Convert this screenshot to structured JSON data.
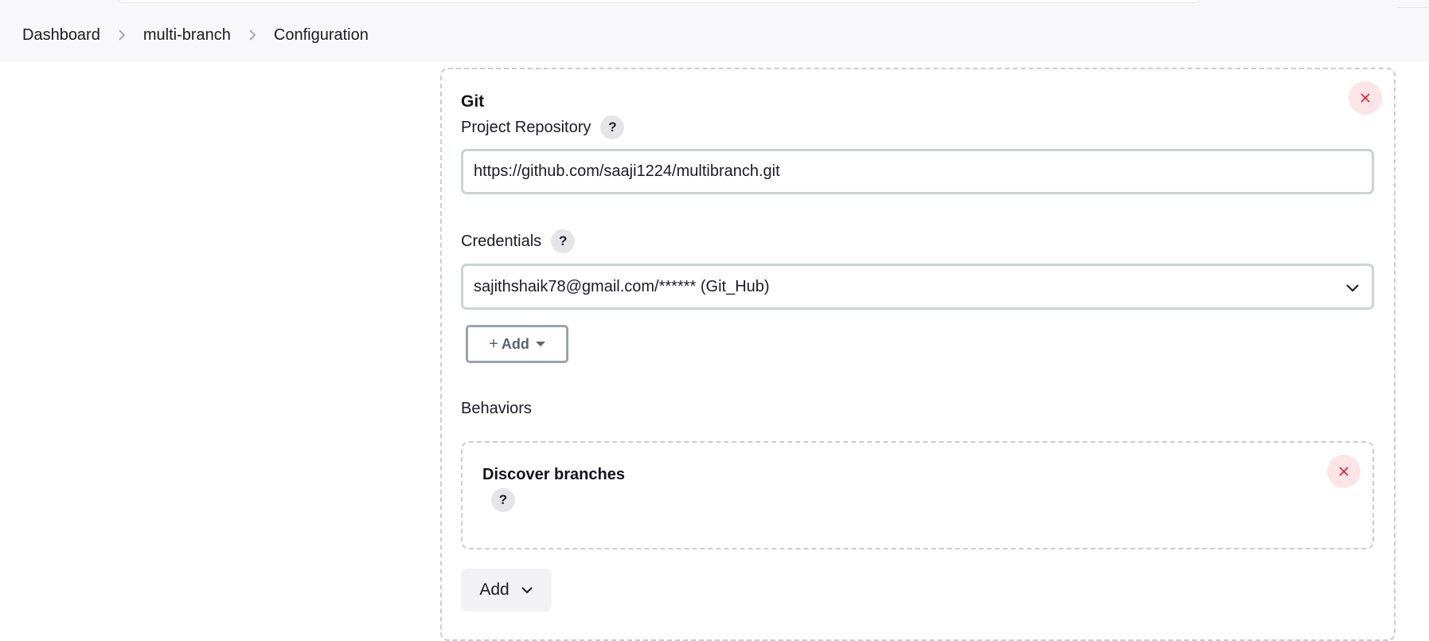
{
  "breadcrumb": {
    "items": [
      "Dashboard",
      "multi-branch",
      "Configuration"
    ]
  },
  "git": {
    "title": "Git",
    "project_repository": {
      "label": "Project Repository",
      "help": "?",
      "value": "https://github.com/saaji1224/multibranch.git"
    },
    "credentials": {
      "label": "Credentials",
      "help": "?",
      "selected": "sajithshaik78@gmail.com/****** (Git_Hub)",
      "add_button": {
        "plus": "+",
        "label": "Add"
      }
    },
    "behaviors": {
      "label": "Behaviors",
      "items": [
        {
          "title": "Discover branches",
          "help": "?"
        }
      ],
      "add_button": "Add"
    }
  },
  "colors": {
    "close_bg": "#fde4e6",
    "close_x": "#e0202f",
    "border_dashed": "#c8cdd2",
    "topbar_bg": "#f8f8fa"
  },
  "icons": [
    "chevron-right-icon",
    "close-icon",
    "chevron-down-icon",
    "plus-icon",
    "caret-down-icon",
    "help-icon"
  ]
}
